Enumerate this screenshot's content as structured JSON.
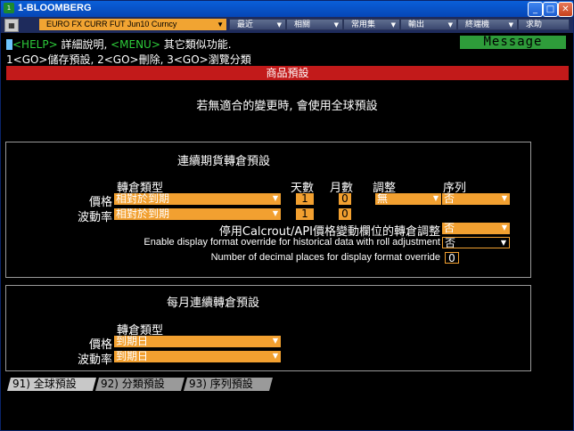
{
  "window": {
    "title": "1-BLOOMBERG",
    "app_icon": "bloomberg-icon",
    "min_glyph": "_",
    "max_glyph": "□",
    "close_glyph": "✕"
  },
  "toolbar": {
    "security": "EURO FX CURR FUT Jun10 Curncy",
    "menus": [
      "最近",
      "相關",
      "常用集",
      "輸出",
      "終端機",
      "求助"
    ]
  },
  "terminal": {
    "help_key": "<HELP>",
    "help_text": " 詳細說明, ",
    "menu_key": "<MENU>",
    "menu_text": " 其它類似功能.",
    "message": "Message",
    "commands": "1<GO>儲存預設, 2<GO>刪除, 3<GO>瀏覽分類",
    "banner": "商品預設",
    "notice": "若無適合的變更時, 會使用全球預設"
  },
  "continuous_panel": {
    "title": "連續期貨轉倉預設",
    "headers": {
      "roll_type": "轉倉類型",
      "days": "天數",
      "months": "月數",
      "adjust": "調整",
      "sequence": "序列"
    },
    "rows": [
      {
        "label": "價格",
        "roll_type": "相對於到期",
        "days": "1",
        "months": "0",
        "adjust": "無",
        "sequence": "否"
      },
      {
        "label": "波動率",
        "roll_type": "相對於到期",
        "days": "1",
        "months": "0"
      }
    ],
    "opt1_label": "停用Calcrout/API價格變動欄位的轉倉調整",
    "opt1_value": "否",
    "opt2_label": "Enable display format override for historical data with roll adjustment",
    "opt2_value": "否",
    "opt3_label": "Number of decimal places for display format override",
    "opt3_value": "0"
  },
  "monthly_panel": {
    "title": "每月連續轉倉預設",
    "header": "轉倉類型",
    "rows": [
      {
        "label": "價格",
        "value": "到期日"
      },
      {
        "label": "波動率",
        "value": "到期日"
      }
    ]
  },
  "tabs": [
    "91) 全球預設",
    "92) 分類預設",
    "93) 序列預設"
  ],
  "colors": {
    "accent": "#f2a030",
    "banner": "#c21a1a",
    "message": "#2e9c3a",
    "help_keys": "#2dcc3a"
  }
}
